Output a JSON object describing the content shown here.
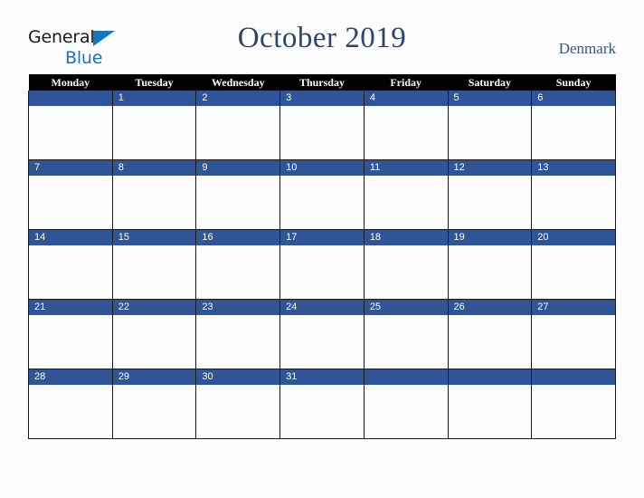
{
  "brand": {
    "name_part1": "General",
    "name_part2": "Blue",
    "triangle_color": "#1574c4"
  },
  "header": {
    "title": "October 2019",
    "country": "Denmark",
    "title_color": "#2b4570"
  },
  "calendar": {
    "weekday_headers": [
      "Monday",
      "Tuesday",
      "Wednesday",
      "Thursday",
      "Friday",
      "Saturday",
      "Sunday"
    ],
    "accent_color": "#2f5597",
    "header_bg": "#000000",
    "weeks": [
      [
        "",
        "1",
        "2",
        "3",
        "4",
        "5",
        "6"
      ],
      [
        "7",
        "8",
        "9",
        "10",
        "11",
        "12",
        "13"
      ],
      [
        "14",
        "15",
        "16",
        "17",
        "18",
        "19",
        "20"
      ],
      [
        "21",
        "22",
        "23",
        "24",
        "25",
        "26",
        "27"
      ],
      [
        "28",
        "29",
        "30",
        "31",
        "",
        "",
        ""
      ]
    ]
  }
}
